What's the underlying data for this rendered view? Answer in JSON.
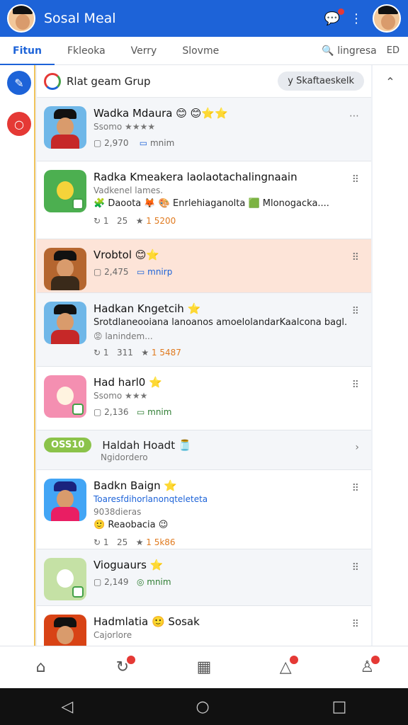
{
  "header": {
    "title": "Sosal Meal"
  },
  "tabs": [
    {
      "label": "Fitun"
    },
    {
      "label": "Fkleoka"
    },
    {
      "label": "Verry"
    },
    {
      "label": "Slovme"
    }
  ],
  "tabs_right": {
    "search_label": "lingresa",
    "end_label": "ED"
  },
  "group": {
    "title": "Rlat geam Grup",
    "pill": "y Skaftaeskelk"
  },
  "items": [
    {
      "name": "Wadka Mdaura 😊 😊⭐⭐",
      "sub": "Ssomo ★★★★",
      "stat1": "2,970",
      "stat2": "mnim"
    },
    {
      "name": "Radka Kmeakera laolaotachalingnaain",
      "sub": "Vadkenel lames.",
      "desc": "🧩 Daoota 🦊 🎨 Enrlehiaganolta 🟩 Mlonogacka....",
      "stat1": "1",
      "stat2": "25",
      "stat3": "1 5200"
    },
    {
      "name": "Vrobtol 😊⭐",
      "stat1": "2,475",
      "stat2": "mnirp"
    },
    {
      "name": "Hadkan Kngetcih ⭐",
      "desc": "Srotdlaneooiana lanoanos amoelolandarKaalcona bagl.",
      "sub": "😡 lanindem...",
      "stat1": "1",
      "stat2": "311",
      "stat3": "1 5487"
    },
    {
      "name": "Had harl0 ⭐",
      "sub": "Ssomo ★★★",
      "stat1": "2,136",
      "stat2": "mnim"
    },
    {
      "name": "Badkn Baign ⭐",
      "desc": "Toaresfdihorlanonqteleteta",
      "sub": "9038dieras",
      "desc2": "🙂 Reaobacia 😉",
      "stat1": "1",
      "stat2": "25",
      "stat3": "1 5k86"
    },
    {
      "name": "Vioguaurs ⭐",
      "stat1": "2,149",
      "stat2": "mnim"
    },
    {
      "name": "Hadmlatia 🙂 Sosak",
      "sub": "Cajorlore"
    }
  ],
  "promo": {
    "tag": "OSS10",
    "name": "Haldah Hoadt 🫙",
    "sub": "Ngidordero"
  },
  "colors": {
    "accent": "#1d63d8",
    "highlight": "#fde4d8",
    "rail_line": "#f0c35a"
  }
}
